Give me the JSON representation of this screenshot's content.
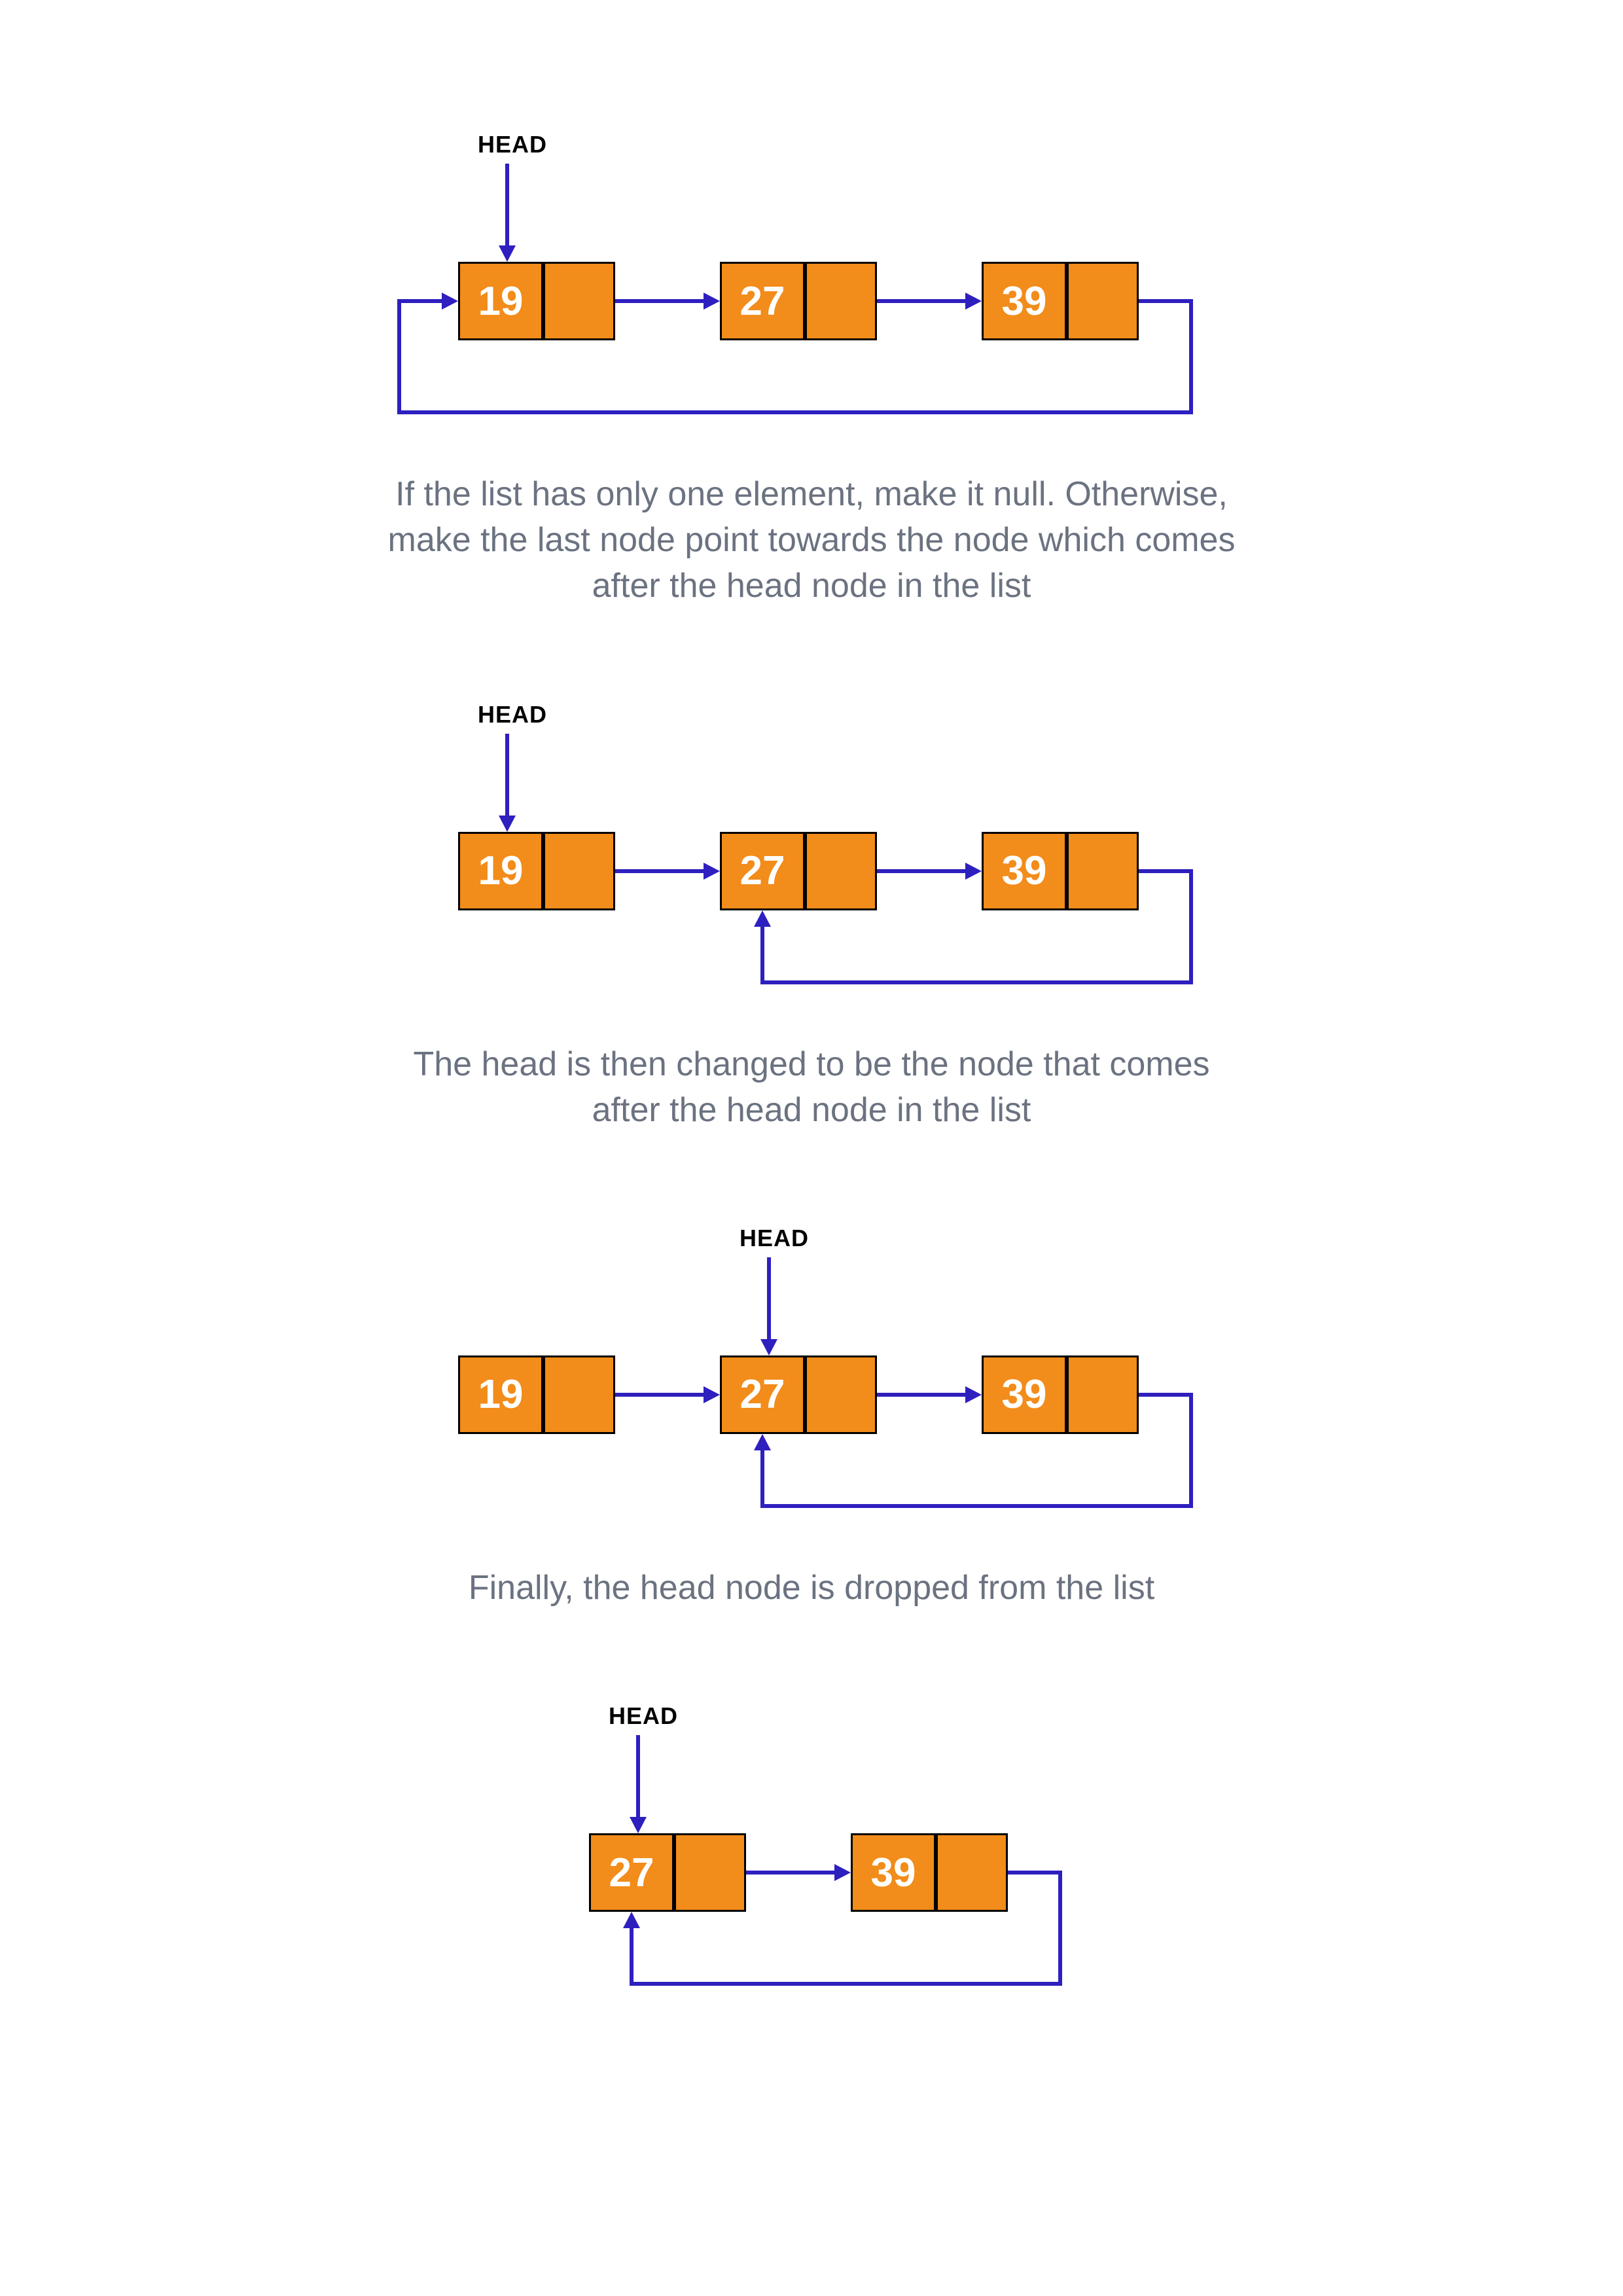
{
  "labels": {
    "head": "HEAD"
  },
  "captions": {
    "c1": "If the list has only one element, make it null. Otherwise, make the last node point towards the node which comes after the head node in the list",
    "c2": "The head is then changed to be the node that comes after the head node in the list",
    "c3": "Finally, the head node is dropped from the list"
  },
  "diagram1": {
    "node1": "19",
    "node2": "27",
    "node3": "39"
  },
  "diagram2": {
    "node1": "19",
    "node2": "27",
    "node3": "39"
  },
  "diagram3": {
    "node1": "19",
    "node2": "27",
    "node3": "39"
  },
  "diagram4": {
    "node1": "27",
    "node2": "39"
  }
}
